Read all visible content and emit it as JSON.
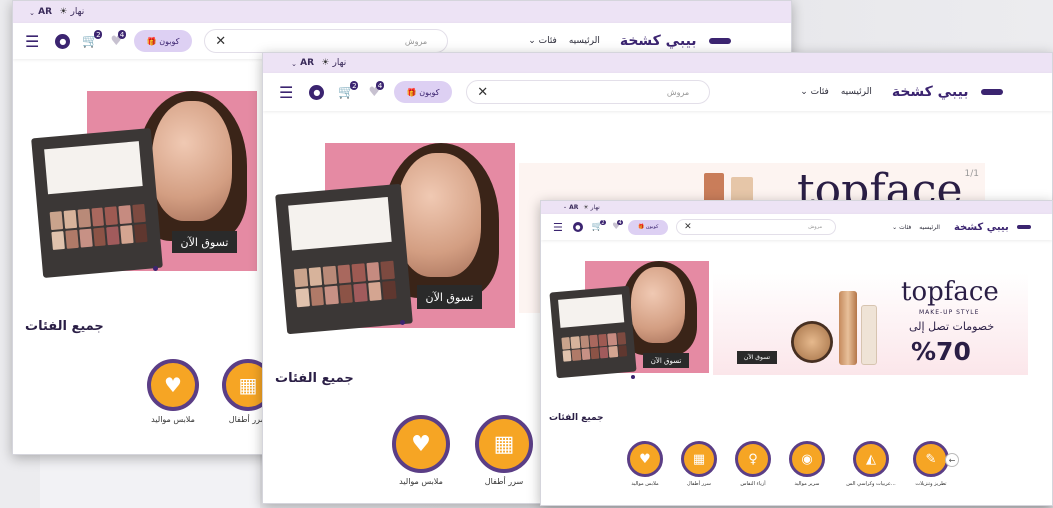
{
  "topbar": {
    "lang": "AR",
    "mode": "نهار"
  },
  "header": {
    "brand": "بيبي كشخة",
    "home": "الرئيسيه",
    "categories": "فئات",
    "search_placeholder": "مروش",
    "coupon": "كوبون",
    "cart_count": "2",
    "wishlist_count": "4"
  },
  "banner": {
    "shop_now": "تسوق الآن"
  },
  "topface": {
    "title": "topface",
    "subtitle": "MAKE-UP STYLE",
    "promo": "خصومات تصل إلى",
    "percent": "%70",
    "counter": "1/1"
  },
  "sections": {
    "all_categories": "جميع الفئات"
  },
  "categories": [
    {
      "label": "ملابس مواليد"
    },
    {
      "label": "سرر أطفال"
    },
    {
      "label": "أزياء النفاس"
    },
    {
      "label": "سرير مواليد"
    },
    {
      "label": "عربيات وكراسي الس..."
    },
    {
      "label": "تطريز وتنزيلات"
    }
  ],
  "colors": {
    "brand": "#3b2470",
    "accent": "#f6a524",
    "pink": "#e58aa3",
    "strip": "#ede3f5"
  }
}
